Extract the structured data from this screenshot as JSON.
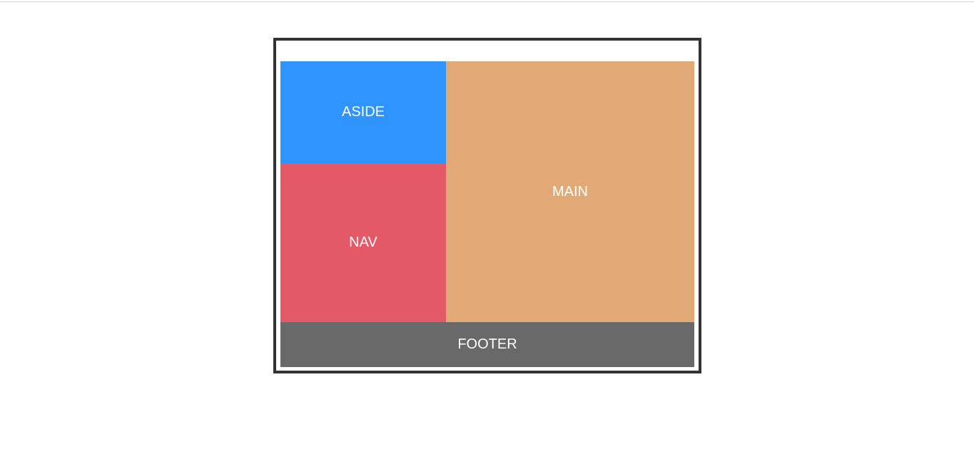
{
  "layout": {
    "aside": {
      "label": "ASIDE",
      "color": "#3094FF"
    },
    "nav": {
      "label": "NAV",
      "color": "#E45967"
    },
    "main": {
      "label": "MAIN",
      "color": "#E0A975"
    },
    "footer": {
      "label": "FOOTER",
      "color": "#696969"
    }
  },
  "frame": {
    "border_color": "#333333"
  }
}
